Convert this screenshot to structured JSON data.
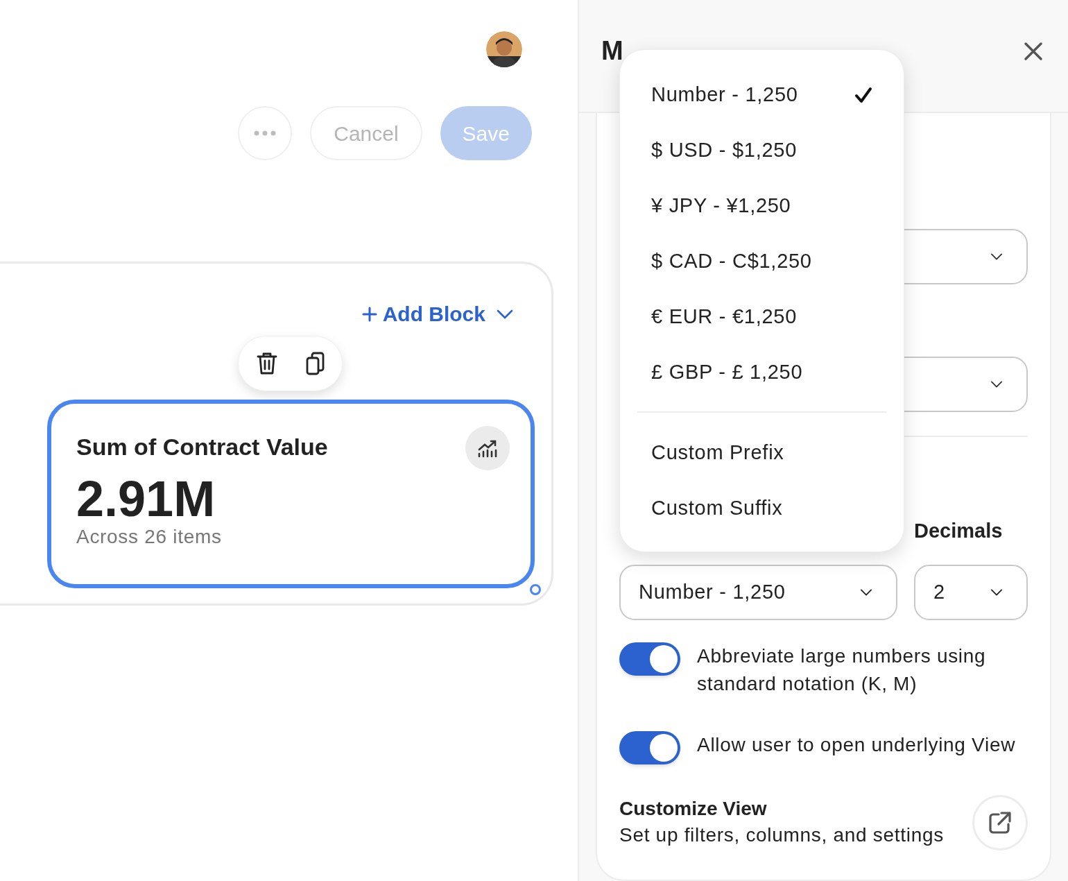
{
  "actions": {
    "buttons": [
      {
        "label": "Cancel",
        "disabled": false
      },
      {
        "label": "Save",
        "disabled": true
      }
    ]
  },
  "canvas": {
    "add_block": "Add Block",
    "metric_card": {
      "title": "Sum of Contract Value",
      "value": "2.91M",
      "caption": "Across 26 items",
      "selected": true
    }
  },
  "panel": {
    "title": "M",
    "decimals_label": "Decimals",
    "format_select": {
      "value": "Number - 1,250"
    },
    "decimals_select": {
      "value": "2"
    },
    "toggles": [
      {
        "label": "Abbreviate large numbers using standard notation (K, M)",
        "on": true
      },
      {
        "label": "Allow user to open underlying View",
        "on": true
      }
    ],
    "customize": {
      "title": "Customize View",
      "subtitle": "Set up filters, columns, and settings"
    }
  },
  "dropdown": {
    "groups": [
      [
        {
          "label": "Number - 1,250",
          "selected": true
        },
        {
          "label": "$ USD - $1,250",
          "selected": false
        },
        {
          "label": "¥ JPY - ¥1,250",
          "selected": false
        },
        {
          "label": "$ CAD - C$1,250",
          "selected": false
        },
        {
          "label": "€ EUR - €1,250",
          "selected": false
        },
        {
          "label": "£ GBP - £ 1,250",
          "selected": false
        }
      ],
      [
        {
          "label": "Custom Prefix",
          "selected": false
        },
        {
          "label": "Custom Suffix",
          "selected": false
        }
      ]
    ]
  }
}
